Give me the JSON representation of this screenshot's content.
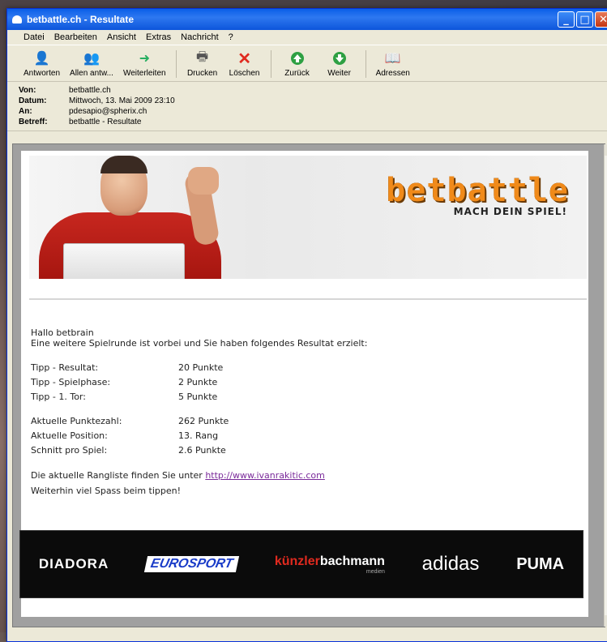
{
  "window": {
    "title": "betbattle.ch - Resultate"
  },
  "menu": [
    "Datei",
    "Bearbeiten",
    "Ansicht",
    "Extras",
    "Nachricht",
    "?"
  ],
  "toolbar": [
    {
      "label": "Antworten",
      "icon": "reply-icon"
    },
    {
      "label": "Allen antw...",
      "icon": "reply-all-icon"
    },
    {
      "label": "Weiterleiten",
      "icon": "forward-icon"
    },
    {
      "label": "Drucken",
      "icon": "print-icon"
    },
    {
      "label": "Löschen",
      "icon": "delete-icon"
    },
    {
      "label": "Zurück",
      "icon": "back-icon"
    },
    {
      "label": "Weiter",
      "icon": "next-icon"
    },
    {
      "label": "Adressen",
      "icon": "address-book-icon"
    }
  ],
  "headers": {
    "from_label": "Von:",
    "from": "betbattle.ch",
    "date_label": "Datum:",
    "date": "Mittwoch, 13. Mai 2009 23:10",
    "to_label": "An:",
    "to": "pdesapio@spherix.ch",
    "subject_label": "Betreff:",
    "subject": "betbattle - Resultate"
  },
  "banner": {
    "logo": "betbattle",
    "slogan": "MACH DEIN SPIEL!"
  },
  "mail": {
    "greeting": "Hallo betbrain",
    "intro": "Eine weitere Spielrunde ist vorbei und Sie haben folgendes Resultat erzielt:",
    "stats1": [
      {
        "label": "Tipp - Resultat:",
        "value": "20 Punkte"
      },
      {
        "label": "Tipp - Spielphase:",
        "value": "2 Punkte"
      },
      {
        "label": "Tipp - 1. Tor:",
        "value": "5 Punkte"
      }
    ],
    "stats2": [
      {
        "label": "Aktuelle Punktezahl:",
        "value": "262 Punkte"
      },
      {
        "label": "Aktuelle Position:",
        "value": "13. Rang"
      },
      {
        "label": "Schnitt pro Spiel:",
        "value": "2.6 Punkte"
      }
    ],
    "ranking_text": "Die aktuelle Rangliste finden Sie unter ",
    "ranking_link": "http://www.ivanrakitic.com",
    "closing": "Weiterhin viel Spass beim tippen!"
  },
  "sponsors": [
    "DIADORA",
    "EUROSPORT",
    "künzler",
    "bachmann",
    "medien",
    "adidas",
    "PUMA"
  ]
}
